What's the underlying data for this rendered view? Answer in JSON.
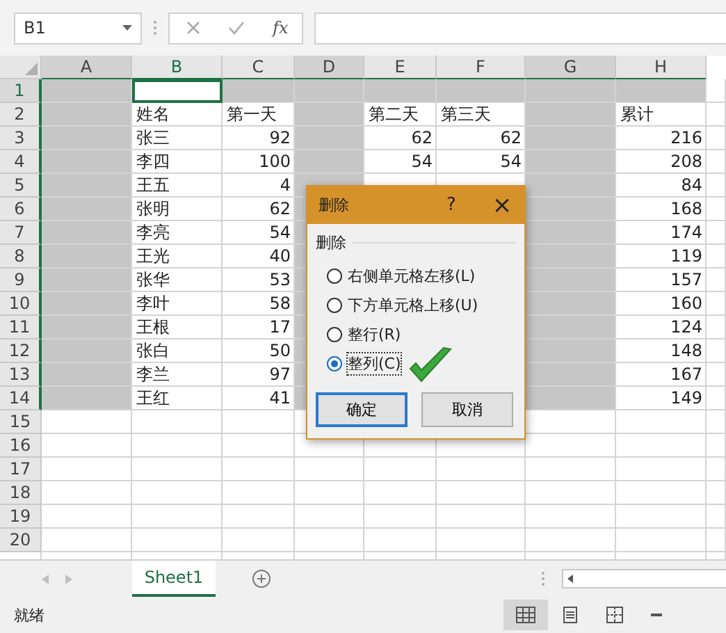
{
  "name_box": {
    "value": "B1"
  },
  "formula_bar": {
    "function_label": "fx"
  },
  "columns": [
    {
      "label": "A",
      "selected": true,
      "active": false
    },
    {
      "label": "B",
      "selected": false,
      "active": true
    },
    {
      "label": "C",
      "selected": false,
      "active": false
    },
    {
      "label": "D",
      "selected": true,
      "active": false
    },
    {
      "label": "E",
      "selected": false,
      "active": false
    },
    {
      "label": "F",
      "selected": false,
      "active": false
    },
    {
      "label": "G",
      "selected": true,
      "active": false
    },
    {
      "label": "H",
      "selected": false,
      "active": false
    }
  ],
  "rows": [
    {
      "header": "1",
      "selected": true,
      "active": true,
      "kind": "data",
      "cells": {}
    },
    {
      "header": "2",
      "selected": false,
      "active": false,
      "kind": "heading",
      "cells": {
        "B": "姓名",
        "C": "第一天",
        "E": "第二天",
        "F": "第三天",
        "H": "累计"
      }
    },
    {
      "header": "3",
      "selected": false,
      "active": false,
      "kind": "data",
      "cells": {
        "B": "张三",
        "C": "92",
        "E": "62",
        "F": "62",
        "H": "216"
      }
    },
    {
      "header": "4",
      "selected": false,
      "active": false,
      "kind": "data",
      "cells": {
        "B": "李四",
        "C": "100",
        "E": "54",
        "F": "54",
        "H": "208"
      }
    },
    {
      "header": "5",
      "selected": false,
      "active": false,
      "kind": "data",
      "cells": {
        "B": "王五",
        "C": "4",
        "H": "84"
      }
    },
    {
      "header": "6",
      "selected": false,
      "active": false,
      "kind": "data",
      "cells": {
        "B": "张明",
        "C": "62",
        "H": "168"
      }
    },
    {
      "header": "7",
      "selected": false,
      "active": false,
      "kind": "data",
      "cells": {
        "B": "李亮",
        "C": "54",
        "H": "174"
      }
    },
    {
      "header": "8",
      "selected": false,
      "active": false,
      "kind": "data",
      "cells": {
        "B": "王光",
        "C": "40",
        "H": "119"
      }
    },
    {
      "header": "9",
      "selected": false,
      "active": false,
      "kind": "data",
      "cells": {
        "B": "张华",
        "C": "53",
        "H": "157"
      }
    },
    {
      "header": "10",
      "selected": false,
      "active": false,
      "kind": "data",
      "cells": {
        "B": "李叶",
        "C": "58",
        "H": "160"
      }
    },
    {
      "header": "11",
      "selected": false,
      "active": false,
      "kind": "data",
      "cells": {
        "B": "王根",
        "C": "17",
        "H": "124"
      }
    },
    {
      "header": "12",
      "selected": false,
      "active": false,
      "kind": "data",
      "cells": {
        "B": "张白",
        "C": "50",
        "H": "148"
      }
    },
    {
      "header": "13",
      "selected": false,
      "active": false,
      "kind": "data",
      "cells": {
        "B": "李兰",
        "C": "97",
        "H": "167"
      }
    },
    {
      "header": "14",
      "selected": false,
      "active": false,
      "kind": "data",
      "cells": {
        "B": "王红",
        "C": "41",
        "H": "149"
      }
    },
    {
      "header": "15",
      "selected": false,
      "active": false,
      "kind": "blank",
      "cells": {}
    },
    {
      "header": "16",
      "selected": false,
      "active": false,
      "kind": "blank",
      "cells": {}
    },
    {
      "header": "17",
      "selected": false,
      "active": false,
      "kind": "blank",
      "cells": {}
    },
    {
      "header": "18",
      "selected": false,
      "active": false,
      "kind": "blank",
      "cells": {}
    },
    {
      "header": "19",
      "selected": false,
      "active": false,
      "kind": "blank",
      "cells": {}
    },
    {
      "header": "20",
      "selected": false,
      "active": false,
      "kind": "blank",
      "cells": {}
    }
  ],
  "dialog": {
    "title": "删除",
    "help": "?",
    "close": "×",
    "group_label": "删除",
    "options": [
      {
        "label": "右侧单元格左移(L)",
        "selected": false
      },
      {
        "label": "下方单元格上移(U)",
        "selected": false
      },
      {
        "label": "整行(R)",
        "selected": false
      },
      {
        "label": "整列(C)",
        "selected": true
      }
    ],
    "buttons": [
      {
        "label": "确定",
        "default": true
      },
      {
        "label": "取消",
        "default": false
      }
    ]
  },
  "sheet_tabs": [
    {
      "label": "Sheet1",
      "selected": true
    }
  ],
  "status_bar": {
    "text": "就绪",
    "views": [
      {
        "kind": "normal",
        "selected": true
      },
      {
        "kind": "layout",
        "selected": false
      },
      {
        "kind": "pagebreak",
        "selected": false
      }
    ]
  }
}
